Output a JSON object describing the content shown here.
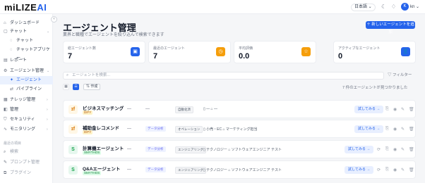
{
  "app": {
    "logo_main": "miLIZE",
    "logo_accent": "AI",
    "language": "日本語 ⌄",
    "user_initial": "K",
    "user_name": "kn ⌄"
  },
  "sidebar": {
    "collapse_label": "‹",
    "items": [
      {
        "label": "ダッシュボード",
        "icon": "home-icon",
        "glyph": "⌂"
      },
      {
        "label": "チャット",
        "icon": "chat-icon",
        "glyph": "▢",
        "chevron": "⌄"
      },
      {
        "label": "チャット",
        "icon": "chat-bubble-icon",
        "glyph": "◌",
        "sub": true
      },
      {
        "label": "チャットアプリケー...",
        "icon": "app-icon",
        "glyph": "◌",
        "sub": true
      },
      {
        "label": "レポート",
        "icon": "report-icon",
        "glyph": "▤"
      },
      {
        "label": "エージェント管理",
        "icon": "agent-icon",
        "glyph": "⚙",
        "chevron": "⌄"
      },
      {
        "label": "エージェント",
        "icon": "bot-icon",
        "glyph": "✦",
        "sub": true
      },
      {
        "label": "パイプライン",
        "icon": "pipeline-icon",
        "glyph": "⇄",
        "sub": true
      },
      {
        "label": "ナレッジ管理",
        "icon": "knowledge-icon",
        "glyph": "▦",
        "chevron": "›"
      },
      {
        "label": "管理",
        "icon": "admin-icon",
        "glyph": "◧",
        "chevron": "›"
      },
      {
        "label": "セキュリティ",
        "icon": "shield-icon",
        "glyph": "⛉",
        "chevron": "›"
      },
      {
        "label": "モニタリング",
        "icon": "monitor-icon",
        "glyph": "∿",
        "chevron": "›"
      }
    ],
    "history_label": "最近の項目",
    "muted_items": [
      {
        "label": "検索",
        "icon": "search-icon",
        "glyph": "⌕"
      },
      {
        "label": "プロンプト管理",
        "icon": "prompt-icon",
        "glyph": "✎"
      },
      {
        "label": "プラグイン",
        "icon": "plugin-icon",
        "glyph": "⧉"
      }
    ]
  },
  "header": {
    "title": "エージェント管理",
    "subtitle": "業界と職種でエージェントを絞り込んで検索できます",
    "add_button": "＋ 新しいエージェントを追加"
  },
  "stats": [
    {
      "label": "総エージェント数",
      "value": "7",
      "icon": "bot-icon",
      "glyph": "▣",
      "color": "#2563eb"
    },
    {
      "label": "最近のエージェント",
      "value": "7",
      "icon": "clock-icon",
      "glyph": "◷",
      "color": "#f59e0b"
    },
    {
      "label": "平均評価",
      "value": "0.0",
      "icon": "star-icon",
      "glyph": "☆",
      "color": "#f59e0b"
    },
    {
      "label": "アクティブなエージェント",
      "value": "0",
      "icon": "user-icon",
      "glyph": "👤",
      "color": "#2563eb"
    }
  ],
  "toolbar": {
    "search_placeholder": "エージェントを検索...",
    "filter_label": "▽ フィルター",
    "grid_icon": "▦",
    "list_icon": "☰",
    "sort_label": "⇅ 作成",
    "count_text": "7 件のエージェントが見つかりました"
  },
  "agents": [
    {
      "name": "ビジネスマッチング",
      "sub": "DIFY",
      "sub_bg": "#fef3c7",
      "sub_fg": "#b45309",
      "icon": "dify-icon",
      "glyph": "ɪf",
      "icon_bg": "#fff7e6",
      "icon_fg": "#d97706",
      "col1": "—",
      "tag_purpose": "",
      "col2": "—",
      "tag_category": "自動化済",
      "meta": "▯ — ⌂ —",
      "try": "試してみる →"
    },
    {
      "name": "補助金レコメンド",
      "sub": "DIFY",
      "sub_bg": "#fef3c7",
      "sub_fg": "#b45309",
      "icon": "dify-icon",
      "glyph": "ɪf",
      "icon_bg": "#fff7e6",
      "icon_fg": "#d97706",
      "col1": "—",
      "tag_purpose": "データ分析",
      "col2": "",
      "tag_category": "オペレーション",
      "meta": "▯ 小売・EC  ⌂ マーケティング担当",
      "try": "試してみる →"
    },
    {
      "name": "計算機エージェント",
      "sub": "SMYTHOS",
      "sub_bg": "#dcfce7",
      "sub_fg": "#15803d",
      "icon": "smythos-icon",
      "glyph": "S",
      "icon_bg": "#e6f7ee",
      "icon_fg": "#16a34a",
      "col1": "—",
      "tag_purpose": "データ分析",
      "col2": "",
      "tag_category": "エンジニアリング",
      "meta": "▯ テクノロジー  ⌂ ソフトウェアエンジニア   テスト",
      "try": "試してみる →"
    },
    {
      "name": "Q&Aエージェント",
      "sub": "SMYTHOS",
      "sub_bg": "#dcfce7",
      "sub_fg": "#15803d",
      "icon": "smythos-icon",
      "glyph": "S",
      "icon_bg": "#e6f7ee",
      "icon_fg": "#16a34a",
      "col1": "—",
      "tag_purpose": "データ分析",
      "col2": "",
      "tag_category": "エンジニアリング",
      "meta": "▯ テクノロジー  ⌂ ソフトウェアエンジニア   テスト",
      "try": "試してみる →"
    }
  ],
  "row_actions": {
    "refresh": "⟳",
    "share": "⎘",
    "view": "◉",
    "edit": "✎",
    "delete": "🗑"
  }
}
